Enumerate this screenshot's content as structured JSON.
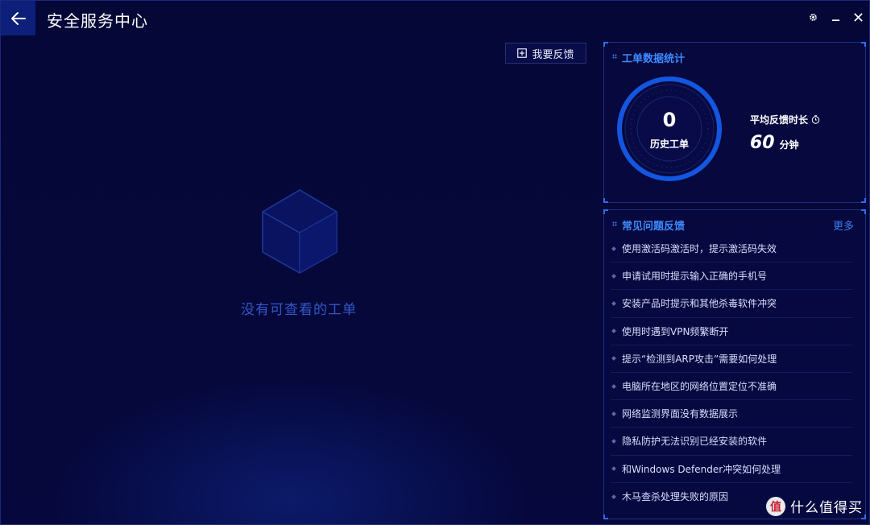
{
  "window": {
    "title": "安全服务中心",
    "back_icon": "arrow-left-icon",
    "controls": [
      "gear-icon",
      "minimize-icon",
      "close-icon"
    ]
  },
  "main": {
    "feedback_button_label": "我要反馈",
    "feedback_button_icon": "plus-square-icon",
    "empty_state_icon": "cube-icon",
    "empty_state_text": "没有可查看的工单"
  },
  "stats": {
    "title": "工单数据统计",
    "history_count": "0",
    "history_label": "历史工单",
    "avg_label": "平均反馈时长",
    "avg_value": "60",
    "avg_unit": "分钟",
    "avg_icon": "clock-icon"
  },
  "faq": {
    "title": "常见问题反馈",
    "more_label": "更多",
    "items": [
      "使用激活码激活时，提示激活码失效",
      "申请试用时提示输入正确的手机号",
      "安装产品时提示和其他杀毒软件冲突",
      "使用时遇到VPN频繁断开",
      "提示“检测到ARP攻击”需要如何处理",
      "电脑所在地区的网络位置定位不准确",
      "网络监测界面没有数据展示",
      "隐私防护无法识别已经安装的软件",
      "和Windows Defender冲突如何处理",
      "木马查杀处理失败的原因"
    ]
  },
  "watermark": {
    "logo_char": "值",
    "text": "什么值得买"
  },
  "colors": {
    "background": "#05063a",
    "accent": "#2f6df0",
    "link": "#3f7ff0",
    "empty_text": "#3158c8"
  }
}
